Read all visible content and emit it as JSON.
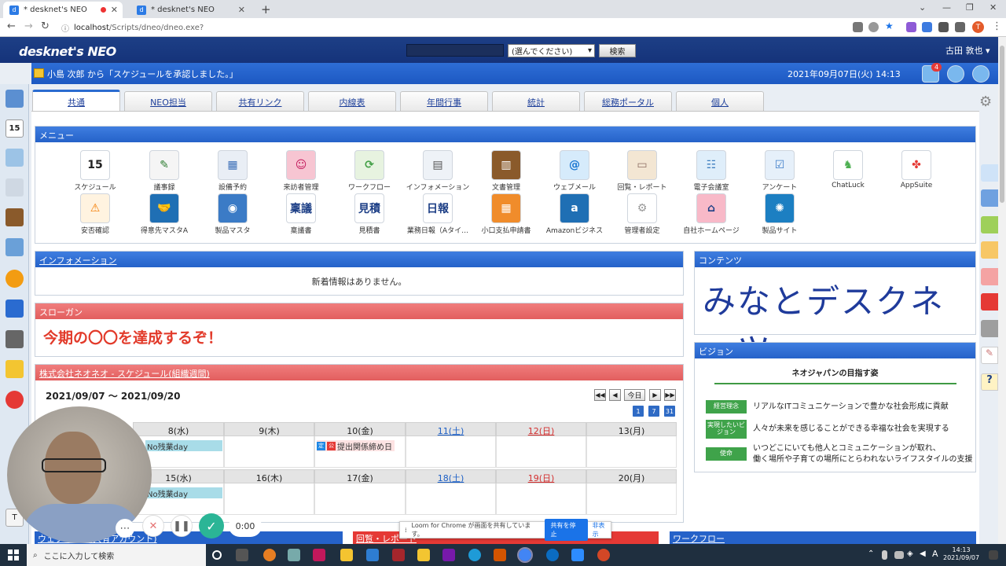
{
  "browser": {
    "tabs": [
      {
        "title": "* desknet's NEO",
        "recording": true
      },
      {
        "title": "* desknet's NEO",
        "recording": false
      }
    ],
    "url_host": "localhost",
    "url_path": "/Scripts/dneo/dneo.exe?",
    "profile_initial": "T"
  },
  "header": {
    "logo_main": "desknet's NEO",
    "search_select": "(選んでください)",
    "search_button": "検索",
    "user_name": "古田 敦也"
  },
  "notification": {
    "text": "小島 次郎 から「スケジュールを承認しました。」",
    "datetime": "2021年09月07日(火) 14:13",
    "badge": "4"
  },
  "portal_tabs": [
    "共通",
    "NEO担当",
    "共有リンク",
    "内線表",
    "年間行事",
    "統計",
    "総務ポータル",
    "個人"
  ],
  "menu": {
    "title": "メニュー",
    "items": [
      {
        "label": "スケジュール",
        "glyph": "15",
        "color": "#ffffff",
        "fg": "#222"
      },
      {
        "label": "議事録",
        "glyph": "✎",
        "color": "#f5f5f5",
        "fg": "#2e7d32"
      },
      {
        "label": "設備予約",
        "glyph": "▦",
        "color": "#e9eef5",
        "fg": "#3c6fb8"
      },
      {
        "label": "来訪者管理",
        "glyph": "☺",
        "color": "#f7c5d2",
        "fg": "#c2185b"
      },
      {
        "label": "ワークフロー",
        "glyph": "⟳",
        "color": "#e7f3e0",
        "fg": "#43a047"
      },
      {
        "label": "インフォメーション",
        "glyph": "▤",
        "color": "#eef2f7",
        "fg": "#555"
      },
      {
        "label": "文書管理",
        "glyph": "▥",
        "color": "#8a5a2b",
        "fg": "#fff"
      },
      {
        "label": "ウェブメール",
        "glyph": "@",
        "color": "#d6ebfb",
        "fg": "#1976d2"
      },
      {
        "label": "回覧・レポート",
        "glyph": "▭",
        "color": "#f3e6d3",
        "fg": "#8d6e63"
      },
      {
        "label": "電子会議室",
        "glyph": "☷",
        "color": "#dfeefa",
        "fg": "#3f7fbf"
      },
      {
        "label": "アンケート",
        "glyph": "☑",
        "color": "#e6f0fa",
        "fg": "#3a7bc8"
      },
      {
        "label": "ChatLuck",
        "glyph": "♞",
        "color": "#ffffff",
        "fg": "#4caf50"
      },
      {
        "label": "AppSuite",
        "glyph": "✤",
        "color": "#ffffff",
        "fg": "#e53935"
      },
      {
        "label": "安否確認",
        "glyph": "⚠",
        "color": "#fff3e0",
        "fg": "#f57c00"
      },
      {
        "label": "得意先マスタA",
        "glyph": "🤝",
        "color": "#1f6fb4",
        "fg": "#fff"
      },
      {
        "label": "製品マスタ",
        "glyph": "◉",
        "color": "#3b7bc6",
        "fg": "#fff"
      },
      {
        "label": "稟議書",
        "glyph": "稟議",
        "color": "#ffffff",
        "fg": "#1d3f86"
      },
      {
        "label": "見積書",
        "glyph": "見積",
        "color": "#ffffff",
        "fg": "#1d3f86"
      },
      {
        "label": "業務日報（Aタイ…",
        "glyph": "日報",
        "color": "#ffffff",
        "fg": "#1d3f86"
      },
      {
        "label": "小口支払申請書",
        "glyph": "▦",
        "color": "#f08c2b",
        "fg": "#fff"
      },
      {
        "label": "Amazonビジネス",
        "glyph": "a",
        "color": "#1f6fb4",
        "fg": "#fff"
      },
      {
        "label": "管理者設定",
        "glyph": "⚙",
        "color": "#ffffff",
        "fg": "#999"
      },
      {
        "label": "自社ホームページ",
        "glyph": "⌂",
        "color": "#f8b9c8",
        "fg": "#1d3f86"
      },
      {
        "label": "製品サイト",
        "glyph": "✺",
        "color": "#1c7fc2",
        "fg": "#fff"
      }
    ]
  },
  "information": {
    "title": "インフォメーション",
    "empty": "新着情報はありません。"
  },
  "slogan": {
    "title": "スローガン",
    "text": "今期の〇〇を達成するぞ！"
  },
  "schedule": {
    "title": "株式会社ネオネオ - スケジュール(組織週間)",
    "range": "2021/09/07 ～ 2021/09/20",
    "today_button": "今日",
    "view_buttons": [
      "1",
      "7",
      "31"
    ],
    "week1": [
      {
        "label": "8(水)",
        "kind": "normal"
      },
      {
        "label": "9(木)",
        "kind": "normal"
      },
      {
        "label": "10(金)",
        "kind": "normal"
      },
      {
        "label": "11(土)",
        "kind": "sat"
      },
      {
        "label": "12(日)",
        "kind": "sun"
      },
      {
        "label": "13(月)",
        "kind": "normal"
      }
    ],
    "week2": [
      {
        "label": "15(水)",
        "kind": "normal"
      },
      {
        "label": "16(木)",
        "kind": "normal"
      },
      {
        "label": "17(金)",
        "kind": "normal"
      },
      {
        "label": "18(土)",
        "kind": "sat"
      },
      {
        "label": "19(日)",
        "kind": "sun"
      },
      {
        "label": "20(月)",
        "kind": "normal"
      }
    ],
    "event_no_overtime": "No残業day",
    "event_deadline": "提出関係締め日",
    "event_deadline_icon1": "定",
    "event_deadline_icon2": "公"
  },
  "contents": {
    "title": "コンテンツ",
    "logo_text": "みなとデスクネッツ"
  },
  "vision": {
    "title": "ビジョン",
    "heading": "ネオジャパンの目指す姿",
    "rows": [
      {
        "tag": "経営理念",
        "text": "リアルなITコミュニケーションで豊かな社会形成に貢献"
      },
      {
        "tag": "実現したいビジョン",
        "text": "人々が未来を感じることができる幸福な社会を実現する"
      },
      {
        "tag": "使命",
        "text": "いつどこにいても他人とコミュニケーションが取れ、",
        "text2": "働く場所や子育ての場所にとらわれないライフスタイルの支援"
      }
    ]
  },
  "bottom_panels": [
    "ウェブメール(共有アカウント)",
    "回覧・レポート",
    "ワークフロー"
  ],
  "loom": {
    "timer": "0:00",
    "share_text": "Loom for Chrome が画面を共有しています。",
    "stop_button": "共有を停止",
    "hide_button": "非表示"
  },
  "taskbar": {
    "search_placeholder": "ここに入力して検索",
    "time": "14:13",
    "date": "2021/09/07"
  },
  "colors": {
    "header_navy": "#1d3f86",
    "blue_panel": "#2562c9",
    "red_panel": "#e25e5e",
    "slogan_red": "#e23a2a"
  }
}
